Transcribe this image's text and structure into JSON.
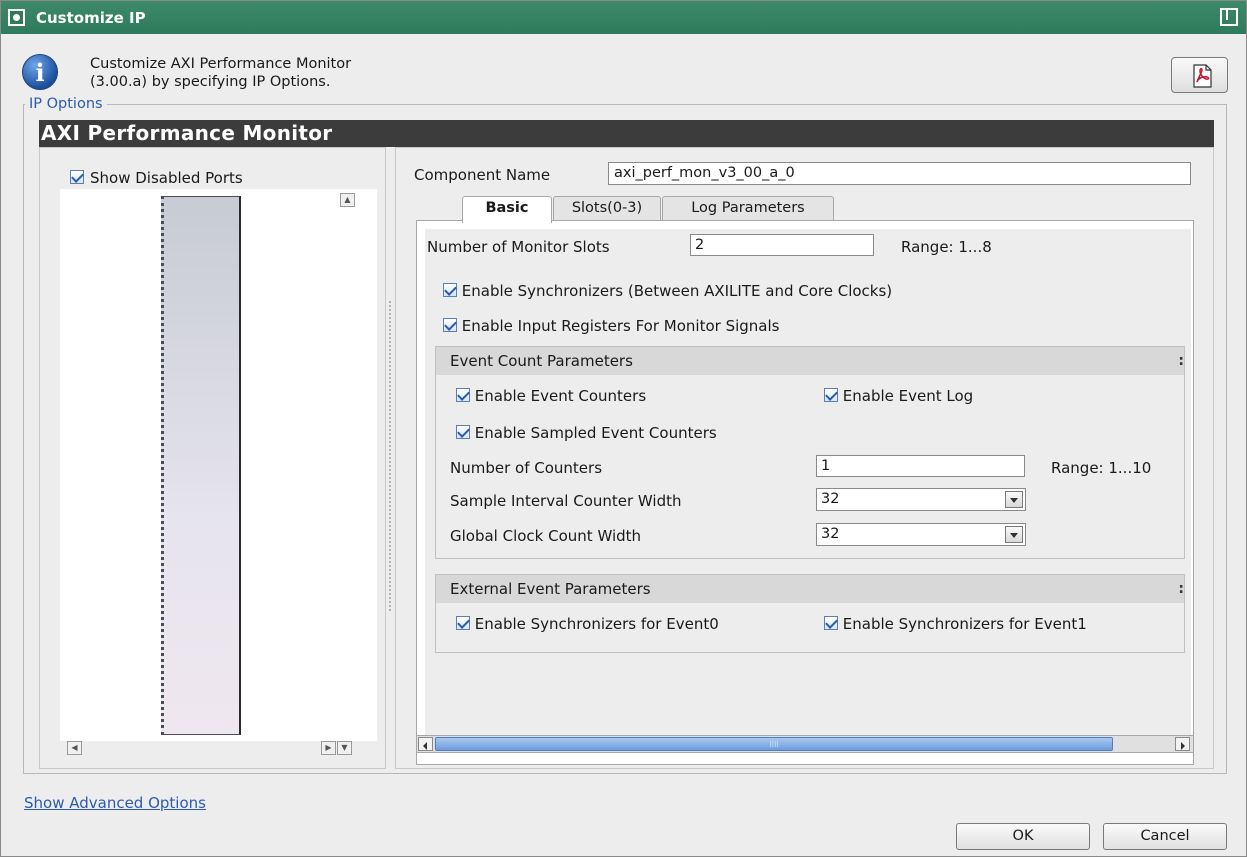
{
  "window": {
    "title": "Customize IP"
  },
  "header": {
    "line1": "Customize AXI Performance Monitor",
    "line2": "(3.00.a) by specifying IP Options."
  },
  "ip_options": {
    "group_label": "IP Options",
    "banner": "AXI Performance Monitor"
  },
  "left_panel": {
    "show_disabled_ports": {
      "label": "Show Disabled Ports",
      "checked": true
    }
  },
  "component": {
    "label": "Component Name",
    "value": "axi_perf_mon_v3_00_a_0"
  },
  "tabs": [
    {
      "label": "Basic",
      "active": true
    },
    {
      "label": "Slots(0-3)",
      "active": false
    },
    {
      "label": "Log Parameters",
      "active": false
    }
  ],
  "basic": {
    "monitor_slots": {
      "label": "Number of Monitor Slots",
      "value": "2",
      "range": "Range: 1...8"
    },
    "enable_synchronizers": {
      "label": "Enable Synchronizers (Between AXILITE and Core Clocks)",
      "checked": true
    },
    "enable_input_registers": {
      "label": "Enable Input Registers For Monitor Signals",
      "checked": true
    },
    "event_count": {
      "title": "Event Count Parameters",
      "enable_event_counters": {
        "label": "Enable Event Counters",
        "checked": true
      },
      "enable_event_log": {
        "label": "Enable Event Log",
        "checked": true
      },
      "enable_sampled_event_counters": {
        "label": "Enable Sampled Event Counters",
        "checked": true
      },
      "number_of_counters": {
        "label": "Number of Counters",
        "value": "1",
        "range": "Range: 1...10"
      },
      "sample_interval_width": {
        "label": "Sample Interval Counter Width",
        "value": "32"
      },
      "global_clock_width": {
        "label": "Global Clock Count Width",
        "value": "32"
      }
    },
    "external_event": {
      "title": "External Event Parameters",
      "sync_event0": {
        "label": "Enable Synchronizers for Event0",
        "checked": true
      },
      "sync_event1": {
        "label": "Enable Synchronizers for Event1",
        "checked": true
      }
    }
  },
  "footer": {
    "advanced_link": "Show Advanced Options",
    "ok": "OK",
    "cancel": "Cancel"
  },
  "colors": {
    "titlebar": "#2e7a5c",
    "banner": "#3c3c3c",
    "link": "#2a5bb0",
    "scroll_thumb": "#6d9ddf"
  },
  "icons": {
    "window": "window-icon",
    "maximize": "maximize-icon",
    "info": "info-icon",
    "pdf": "pdf-icon",
    "dropdown": "chevron-down-icon"
  }
}
